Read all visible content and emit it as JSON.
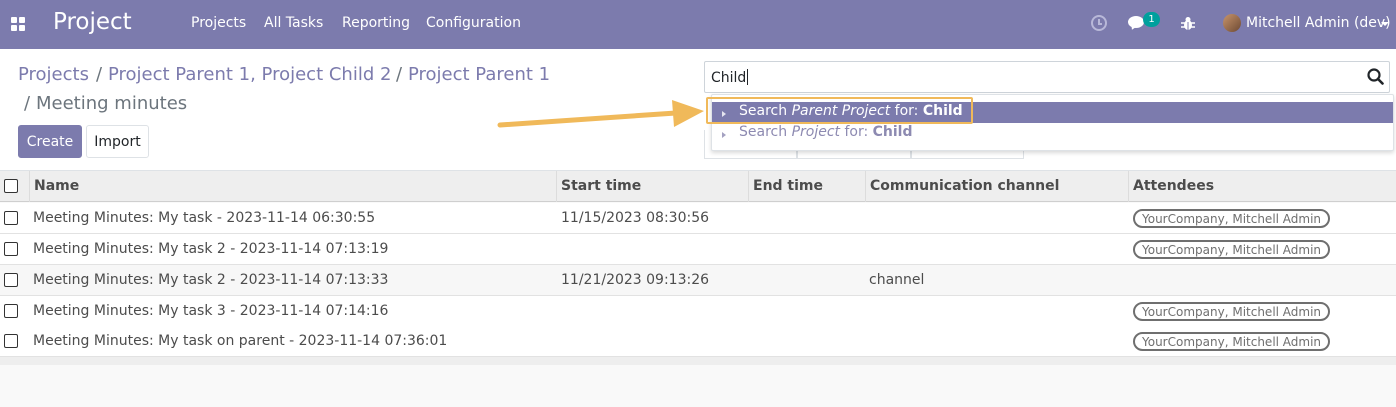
{
  "navbar": {
    "app_title": "Project",
    "menu": [
      "Projects",
      "All Tasks",
      "Reporting",
      "Configuration"
    ],
    "chat_badge": "1",
    "user_name": "Mitchell Admin (dev)",
    "colors": {
      "bar": "#7c7bad",
      "badge": "#00a09d"
    }
  },
  "breadcrumb": {
    "items": [
      "Projects",
      "Project Parent 1, Project Child 2",
      "Project Parent 1"
    ],
    "separator": "/",
    "current": "Meeting minutes"
  },
  "buttons": {
    "create": "Create",
    "import": "Import"
  },
  "search": {
    "value": "Child",
    "suggestions": [
      {
        "prefix": "Search ",
        "field": "Parent Project",
        "mid": " for: ",
        "term": "Child",
        "active": true
      },
      {
        "prefix": "Search ",
        "field": "Project",
        "mid": " for: ",
        "term": "Child",
        "active": false
      }
    ]
  },
  "table": {
    "columns": [
      "Name",
      "Start time",
      "End time",
      "Communication channel",
      "Attendees"
    ],
    "rows": [
      {
        "name": "Meeting Minutes: My task - 2023-11-14 06:30:55",
        "start": "11/15/2023 08:30:56",
        "end": "",
        "channel": "",
        "attendees": "YourCompany, Mitchell Admin"
      },
      {
        "name": "Meeting Minutes: My task 2 - 2023-11-14 07:13:19",
        "start": "",
        "end": "",
        "channel": "",
        "attendees": "YourCompany, Mitchell Admin"
      },
      {
        "name": "Meeting Minutes: My task 2 - 2023-11-14 07:13:33",
        "start": "11/21/2023 09:13:26",
        "end": "",
        "channel": "channel",
        "attendees": ""
      },
      {
        "name": "Meeting Minutes: My task 3 - 2023-11-14 07:14:16",
        "start": "",
        "end": "",
        "channel": "",
        "attendees": "YourCompany, Mitchell Admin"
      },
      {
        "name": "Meeting Minutes: My task on parent - 2023-11-14 07:36:01",
        "start": "",
        "end": "",
        "channel": "",
        "attendees": "YourCompany, Mitchell Admin"
      }
    ]
  },
  "icons": [
    "apps-grid-icon",
    "clock-icon",
    "chat-icon",
    "bug-icon",
    "avatar",
    "search-icon",
    "caret-right-icon"
  ],
  "annotation_color": "#f0b95a"
}
